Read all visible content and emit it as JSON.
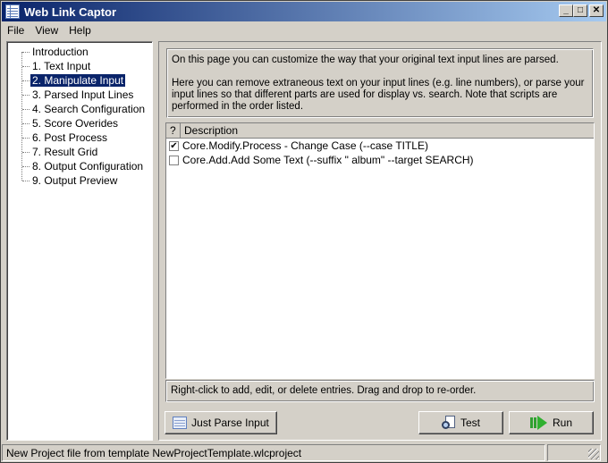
{
  "window": {
    "title": "Web Link Captor",
    "controls": {
      "minimize": "_",
      "maximize": "□",
      "close": "✕"
    }
  },
  "menu": [
    "File",
    "View",
    "Help"
  ],
  "tree": {
    "items": [
      {
        "label": "Introduction",
        "selected": false
      },
      {
        "label": "1. Text Input",
        "selected": false
      },
      {
        "label": "2. Manipulate Input",
        "selected": true
      },
      {
        "label": "3. Parsed Input Lines",
        "selected": false
      },
      {
        "label": "4. Search Configuration",
        "selected": false
      },
      {
        "label": "5. Score Overides",
        "selected": false
      },
      {
        "label": "6. Post Process",
        "selected": false
      },
      {
        "label": "7. Result Grid",
        "selected": false
      },
      {
        "label": "8. Output Configuration",
        "selected": false
      },
      {
        "label": "9. Output Preview",
        "selected": false
      }
    ]
  },
  "intro": {
    "paragraph1": "On this page you can customize the way that your original text input lines are parsed.",
    "paragraph2": "Here you can remove extraneous text on your input lines (e.g. line numbers), or parse your input lines so that different parts are used for display vs. search. Note that scripts are performed in the order listed."
  },
  "list": {
    "columns": [
      "?",
      "Description"
    ],
    "rows": [
      {
        "checked": true,
        "description": "Core.Modify.Process - Change Case (--case TITLE)"
      },
      {
        "checked": false,
        "description": "Core.Add.Add Some Text (--suffix \" album\" --target SEARCH)"
      }
    ]
  },
  "hint": "Right-click to add, edit, or delete entries.  Drag and drop to re-order.",
  "buttons": {
    "parse": "Just Parse Input",
    "test": "Test",
    "run": "Run"
  },
  "status": {
    "message": "New Project file from template NewProjectTemplate.wlcproject"
  },
  "checkmark": "✔"
}
